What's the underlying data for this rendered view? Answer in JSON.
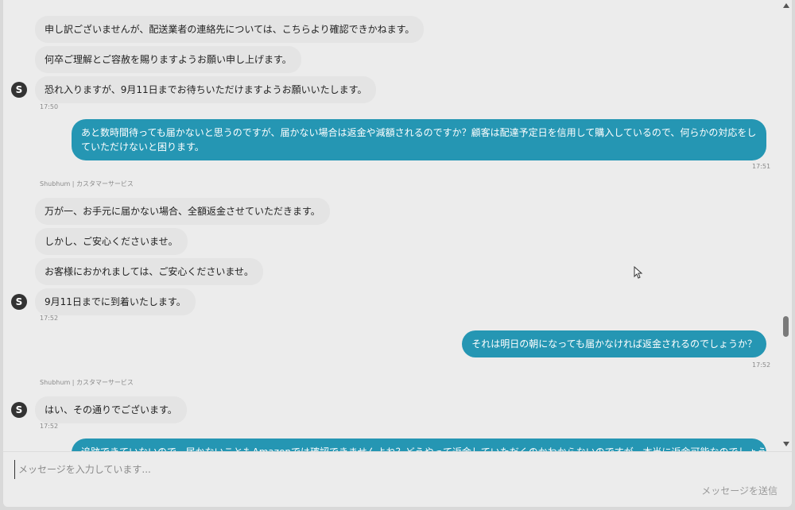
{
  "messages": {
    "m1": "申し訳ございませんが、配送業者の連絡先については、こちらより確認できかねます。",
    "m2": "何卒ご理解とご容赦を賜りますようお願い申し上げます。",
    "m3": "恐れ入りますが、9月11日までお待ちいただけますようお願いいたします。",
    "t1": "17:50",
    "u1": "あと数時間待っても届かないと思うのですが、届かない場合は返金や減額されるのですか？顧客は配達予定日を信用して購入しているので、何らかの対応をしていただけないと困ります。",
    "t2": "17:51",
    "sender": "Shubhum | カスタマーサービス",
    "m4": "万が一、お手元に届かない場合、全額返金させていただきます。",
    "m5": "しかし、ご安心くださいませ。",
    "m6": "お客様におかれましては、ご安心くださいませ。",
    "m7": "9月11日までに到着いたします。",
    "t3": "17:52",
    "u2": "それは明日の朝になっても届かなければ返金されるのでしょうか？",
    "t4": "17:52",
    "m8": "はい、その通りでございます。",
    "t5": "17:52",
    "u3": "追跡できていないので、届かないこともAmazonでは確認できませんよね？どうやって返金していただくのかわからないのですが、本当に返金可能なのでしょうか"
  },
  "avatar_letter": "S",
  "composer": {
    "placeholder": "メッセージを入力しています...",
    "send_label": "メッセージを送信"
  },
  "colors": {
    "outgoing": "#2596b3",
    "incoming": "#e4e4e4"
  }
}
